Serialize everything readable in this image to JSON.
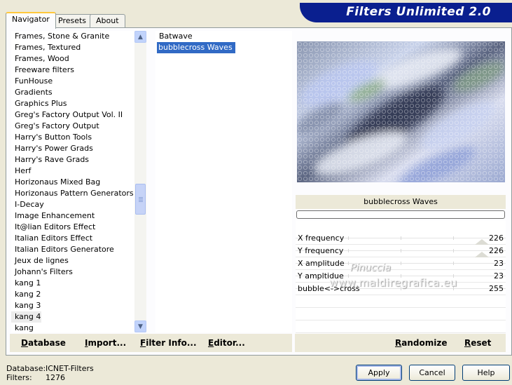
{
  "app": {
    "title": "Filters Unlimited 2.0"
  },
  "tabs": [
    {
      "label": "Navigator"
    },
    {
      "label": "Presets"
    },
    {
      "label": "About"
    }
  ],
  "categories": [
    "Frames, Stone & Granite",
    "Frames, Textured",
    "Frames, Wood",
    "Freeware filters",
    "FunHouse",
    "Gradients",
    "Graphics Plus",
    "Greg's Factory Output Vol. II",
    "Greg's Factory Output",
    "Harry's Button Tools",
    "Harry's Power Grads",
    "Harry's Rave Grads",
    "Herf",
    "Horizonaus Mixed Bag",
    "Horizonaus Pattern Generators",
    "I-Decay",
    "Image Enhancement",
    "It@lian Editors Effect",
    "Italian Editors Effect",
    "Italian Editors Generatore",
    "Jeux de lignes",
    "Johann's Filters",
    "kang 1",
    "kang 2",
    "kang 3",
    "kang 4",
    "kang"
  ],
  "selected_category": "kang 4",
  "filters": [
    "Batwave",
    "bubblecross Waves"
  ],
  "selected_filter": "bubblecross Waves",
  "left_buttons": {
    "database": "Database",
    "import": "Import...",
    "filter_info": "Filter Info...",
    "editor": "Editor..."
  },
  "right_buttons": {
    "randomize": "Randomize",
    "reset": "Reset"
  },
  "filter_name": "bubblecross Waves",
  "params": [
    {
      "label": "X frequency",
      "value": "226"
    },
    {
      "label": "Y frequency",
      "value": "226"
    },
    {
      "label": "X amplitude",
      "value": "23"
    },
    {
      "label": "Y ampltidue",
      "value": "23"
    },
    {
      "label": "bubble<->cross",
      "value": "255"
    }
  ],
  "watermark": {
    "line1": "Pinuccia",
    "line2": "www.maldiregrafica.eu"
  },
  "footer": {
    "database_label": "Database:",
    "database_value": "ICNET-Filters",
    "filters_label": "Filters:",
    "filters_value": "1276"
  },
  "dialog_buttons": {
    "apply": "Apply",
    "cancel": "Cancel",
    "help": "Help"
  },
  "colors": {
    "banner": "#0a1f8f",
    "selection": "#316ac5",
    "tab_highlight": "#ffc83c"
  },
  "icons": {
    "scroll_up": "chevron-up-icon",
    "scroll_down": "chevron-down-icon"
  }
}
